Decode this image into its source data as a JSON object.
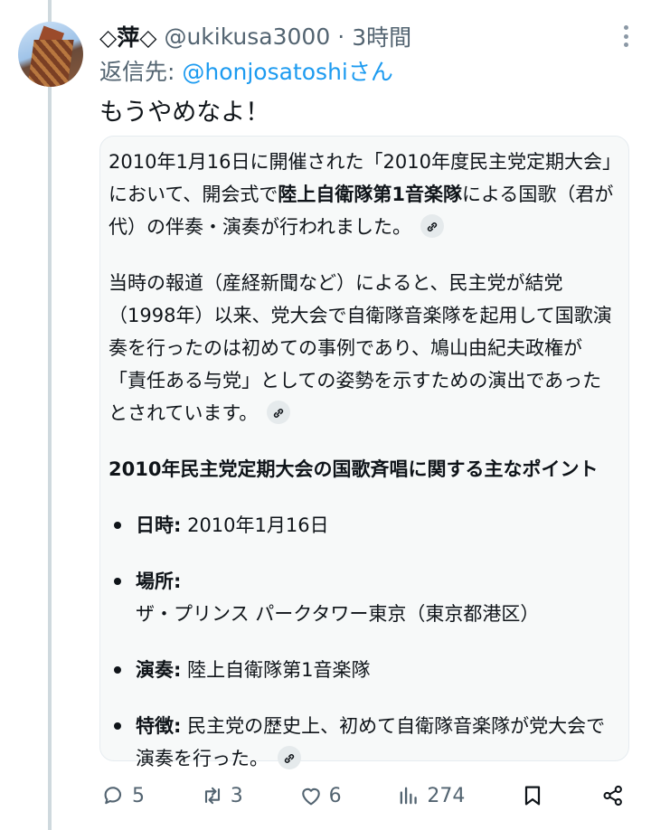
{
  "tweet": {
    "display_name": "◇萍◇",
    "handle": "@ukikusa3000",
    "separator": "·",
    "time": "3時間",
    "reply_prefix": "返信先: ",
    "reply_mention": "@honjosatoshi",
    "reply_suffix": "さん",
    "text": "もうやめなよ！"
  },
  "card": {
    "p1_a": "2010年1月16日に開催された「2010年度民主党定期大会」において、開会式で",
    "p1_bold": "陸上自衛隊第1音楽隊",
    "p1_b": "による国歌（君が代）の伴奏・演奏が行われました。",
    "p2": "当時の報道（産経新聞など）によると、民主党が結党（1998年）以来、党大会で自衛隊音楽隊を起用して国歌演奏を行ったのは初めての事例であり、鳩山由紀夫政権が「責任ある与党」としての姿勢を示すための演出であったとされています。",
    "heading": "2010年民主党定期大会の国歌斉唱に関する主なポイント",
    "points": [
      {
        "label": "日時:",
        "value": " 2010年1月16日"
      },
      {
        "label": "場所:",
        "value": "ザ・プリンス パークタワー東京（東京都港区）"
      },
      {
        "label": "演奏:",
        "value": " 陸上自衛隊第1音楽隊"
      },
      {
        "label": "特徴:",
        "value": " 民主党の歴史上、初めて自衛隊音楽隊が党大会で演奏を行った。"
      }
    ]
  },
  "actions": {
    "replies": "5",
    "retweets": "3",
    "likes": "6",
    "views": "274"
  },
  "colors": {
    "mention": "#1d9bf0",
    "secondary_text": "#536471",
    "thread_line": "#cfd9de",
    "card_bg": "#f7f9f9"
  }
}
